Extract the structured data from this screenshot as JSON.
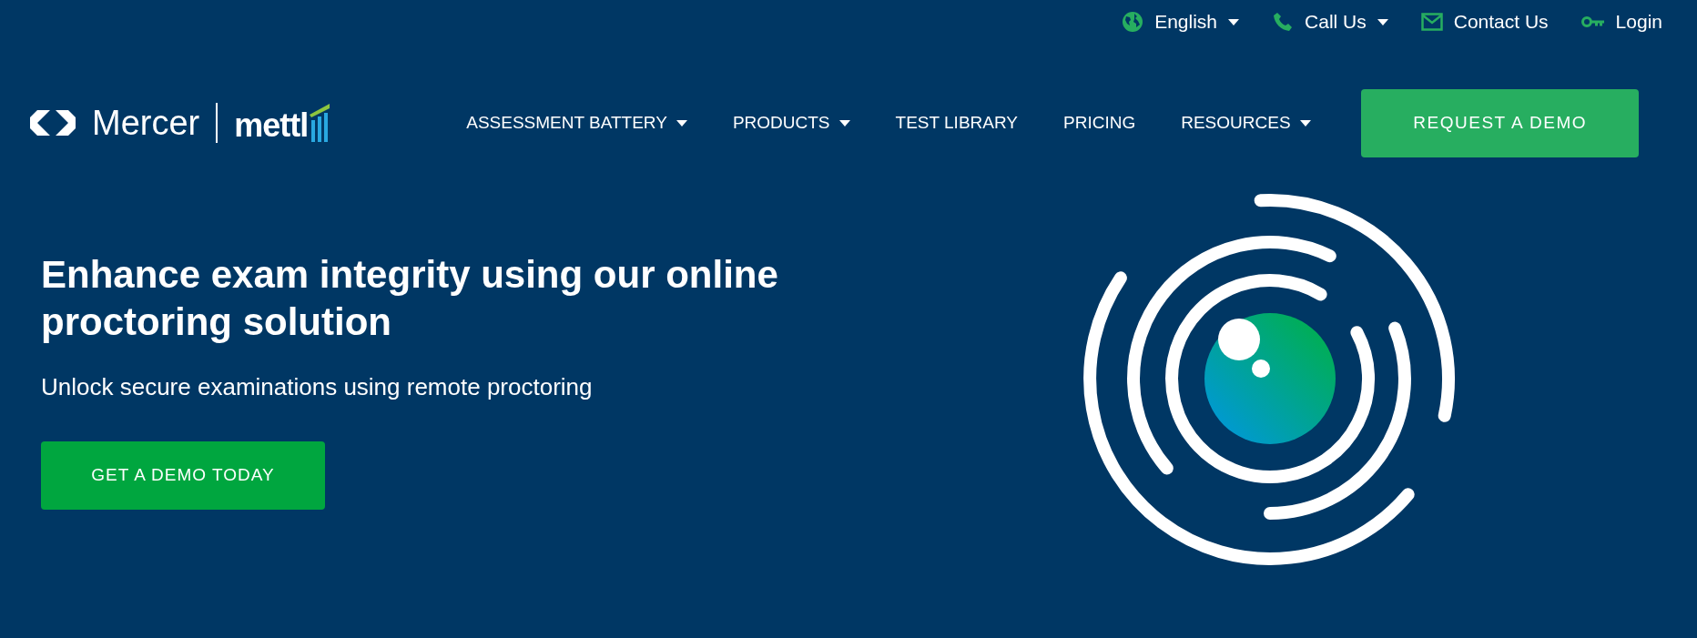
{
  "utility_bar": [
    {
      "label": "English",
      "dropdown": true
    },
    {
      "label": "Call Us",
      "dropdown": true
    },
    {
      "label": "Contact Us",
      "dropdown": false
    },
    {
      "label": "Login",
      "dropdown": false
    }
  ],
  "logo": {
    "brand": "Mercer",
    "product": "mettl"
  },
  "nav": [
    {
      "label": "ASSESSMENT BATTERY",
      "dropdown": true
    },
    {
      "label": "PRODUCTS",
      "dropdown": true
    },
    {
      "label": "TEST LIBRARY",
      "dropdown": false
    },
    {
      "label": "PRICING",
      "dropdown": false
    },
    {
      "label": "RESOURCES",
      "dropdown": true
    }
  ],
  "nav_button": "REQUEST A DEMO",
  "hero": {
    "headline": "Enhance exam integrity using our online proctoring solution",
    "subtitle": "Unlock secure examinations using remote proctoring",
    "button": "GET A DEMO TODAY"
  }
}
